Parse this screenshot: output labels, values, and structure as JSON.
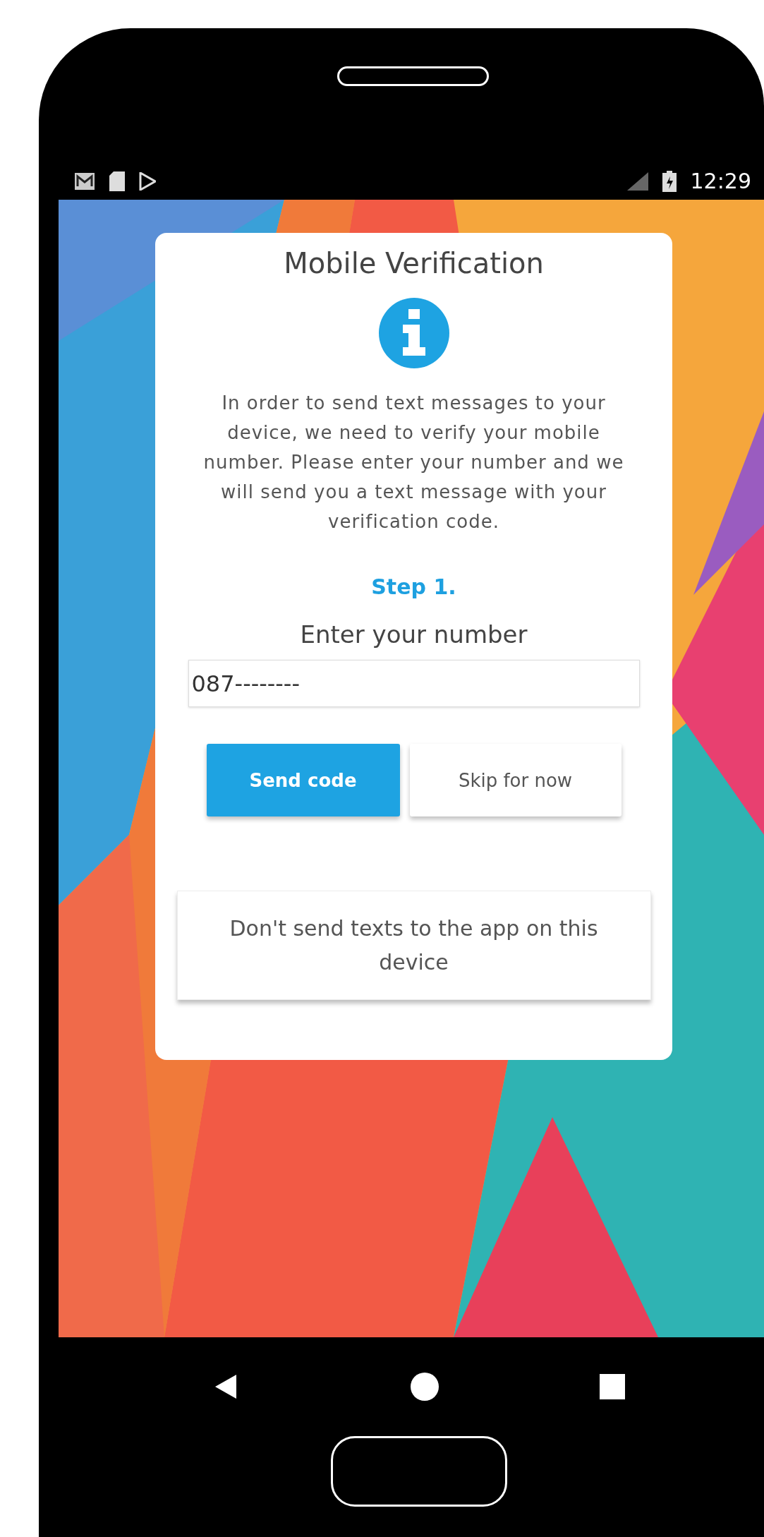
{
  "status_bar": {
    "time": "12:29"
  },
  "card": {
    "title": "Mobile Verification",
    "message": "In order to send text messages to your device, we need to verify your mobile number. Please enter your number and we will send you a text message with your verification code.",
    "step": "Step 1.",
    "prompt": "Enter your number",
    "number_field": {
      "value": "087--------"
    },
    "buttons": [
      {
        "label": "Send code",
        "kind": "primary"
      },
      {
        "label": "Skip for now",
        "kind": "secondary"
      }
    ],
    "opt_out_button": {
      "label": "Don't send texts to the app on this device"
    }
  }
}
